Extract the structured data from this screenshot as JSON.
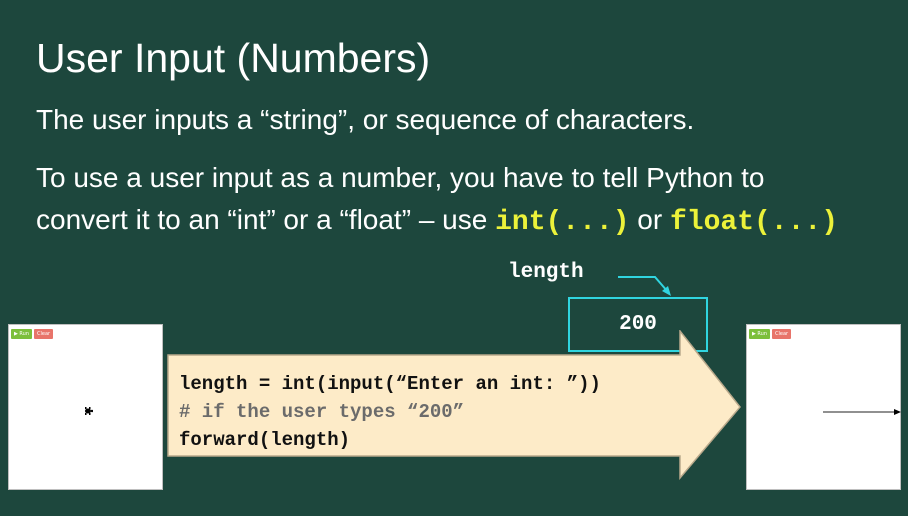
{
  "slide": {
    "title": "User Input (Numbers)",
    "para1": "The user inputs a “string”, or sequence of characters.",
    "para2_line1": "To use a user input as a number, you have to tell Python to",
    "para2_line2_pre": "convert it to an “int” or a “float” – use ",
    "para2_code1": "int(...)",
    "para2_mid": " or ",
    "para2_code2": "float(...)"
  },
  "variable": {
    "name": "length",
    "value": "200"
  },
  "code_block": {
    "line1": "length = int(input(“Enter an int: ”))",
    "line2": "# if the user types “200”",
    "line3": "forward(length)"
  },
  "turtle_before": {
    "run_label": "▶ Run",
    "clear_label": "Clear"
  },
  "turtle_after": {
    "run_label": "▶ Run",
    "clear_label": "Clear"
  },
  "colors": {
    "background": "#1d473d",
    "code_highlight": "#ecf23a",
    "box_border": "#30d5e0",
    "arrow_fill": "#fdebc8"
  }
}
